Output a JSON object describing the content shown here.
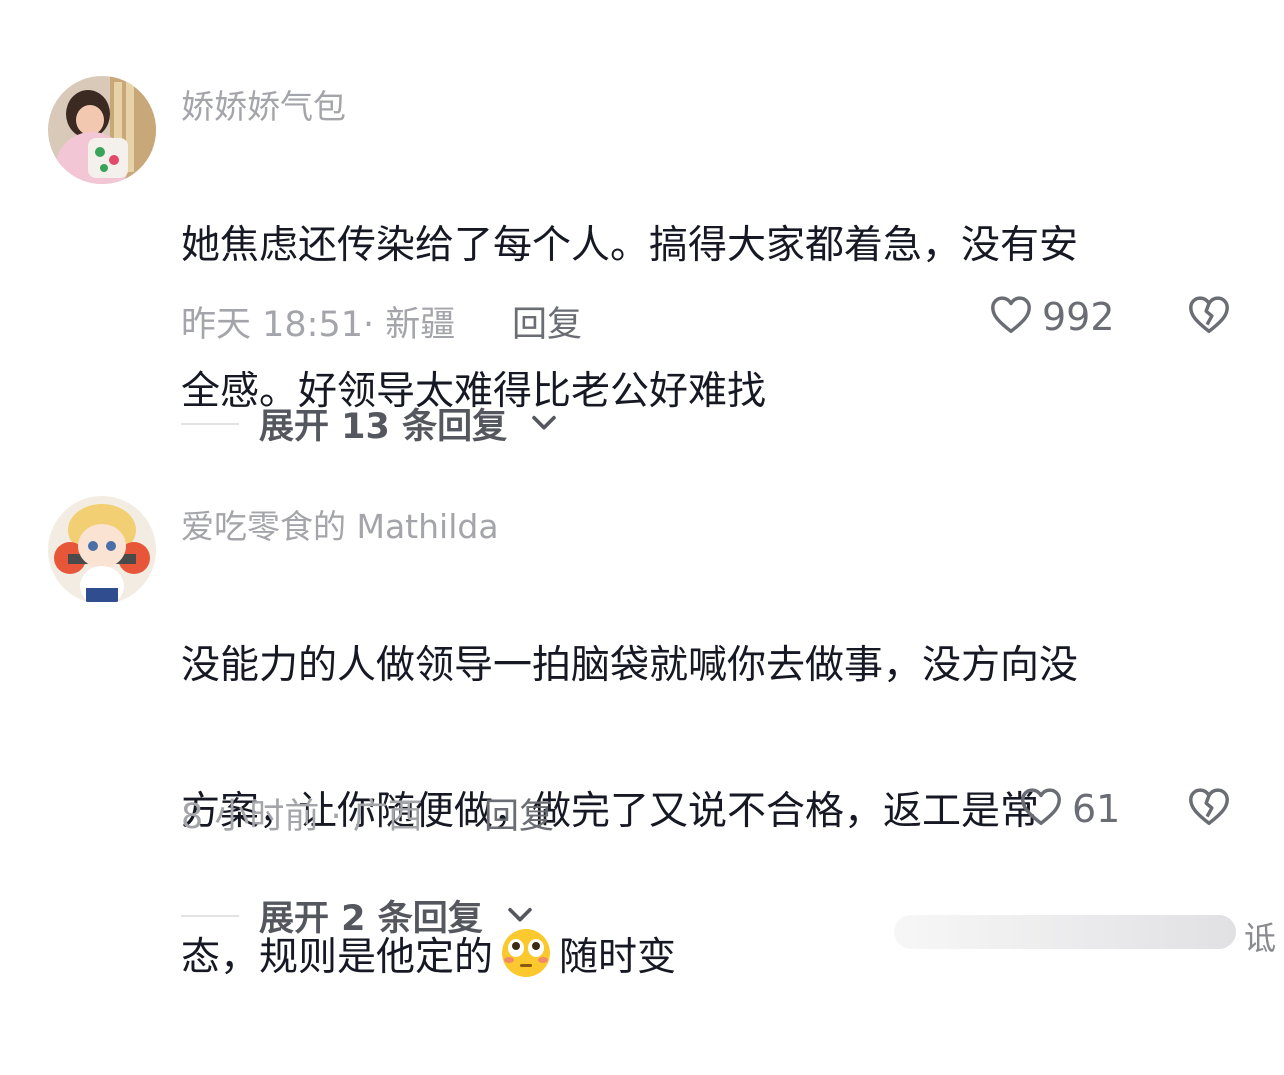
{
  "comments": [
    {
      "username": "娇娇娇气包",
      "text_lines": [
        "她焦虑还传染给了每个人。搞得大家都着急，没有安",
        "全感。好领导太难得比老公好难找"
      ],
      "time_location": "昨天 18:51· 新疆",
      "reply_label": "回复",
      "like_count": "992",
      "expand_label": "展开 13 条回复"
    },
    {
      "username": "爱吃零食的 Mathilda",
      "text_lines": [
        "没能力的人做领导一拍脑袋就喊你去做事，没方向没",
        "方案，让你随便做，做完了又说不合格，返工是常"
      ],
      "text_line3_before_emoji": "态，规则是他定的",
      "text_line3_after_emoji": "随时变",
      "time_location": "8 小时前 · 广西",
      "reply_label": "回复",
      "like_count": "61",
      "expand_label": "展开 2 条回复"
    }
  ],
  "watermark_text": "诋",
  "icons": {
    "like": "heart-outline-icon",
    "dislike": "broken-heart-icon",
    "expand": "chevron-down-icon",
    "emoji": "flushed-face-emoji"
  },
  "colors": {
    "text": "#161823",
    "secondary": "#a4a5aa",
    "action": "#6b6d74"
  }
}
